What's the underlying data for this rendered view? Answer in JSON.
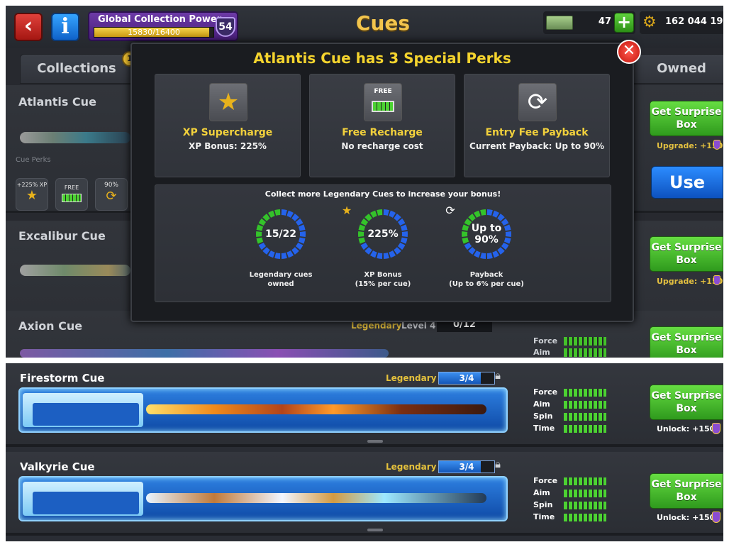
{
  "header": {
    "title": "Cues",
    "collection_power": {
      "label": "Global Collection Power",
      "progress": "15830/16400",
      "fraction": 0.965,
      "level": "54"
    },
    "cash": "47",
    "coins": "162 044 19",
    "back_icon": "chevron-left-icon",
    "info_icon": "info-icon"
  },
  "tabs": {
    "collections": "Collections",
    "owned": "Owned",
    "badge": "1"
  },
  "background_rows": [
    {
      "name": "Atlantis Cue",
      "button": "Get Surprise Box",
      "upgrade": "Upgrade: +150"
    },
    {
      "name": "Excalibur Cue",
      "button": "Get Surprise Box",
      "upgrade": "Upgrade: +150"
    },
    {
      "name": "Axion Cue",
      "tag": "Legendary",
      "level": "Level 4",
      "progress": "0/12",
      "button": "Get Surprise Box"
    }
  ],
  "atlantis_perks_chips": {
    "label": "Cue Perks",
    "xp": "+225% XP",
    "free": "FREE",
    "payback": "90%"
  },
  "use_button": "Use",
  "small_stats": [
    "Force",
    "Aim"
  ],
  "modal": {
    "title": "Atlantis Cue has 3 Special Perks",
    "perks": [
      {
        "name": "XP Supercharge",
        "desc": "XP Bonus: 225%",
        "icon": "star-chevron-icon"
      },
      {
        "name": "Free Recharge",
        "desc": "No recharge cost",
        "icon": "battery-icon",
        "icon_text": "FREE"
      },
      {
        "name": "Entry Fee Payback",
        "desc": "Current Payback: Up to 90%",
        "icon": "coin-cycle-icon"
      }
    ],
    "bonus_title": "Collect more Legendary Cues to increase your bonus!",
    "rings": [
      {
        "value": "15/22",
        "label1": "Legendary cues",
        "label2": "owned",
        "fill": 0.68
      },
      {
        "value": "225%",
        "label1": "XP Bonus",
        "label2": "(15% per cue)",
        "fill": 0.68
      },
      {
        "value": "Up to 90%",
        "label1": "Payback",
        "label2": "(Up to 6% per cue)",
        "fill": 0.68
      }
    ]
  },
  "bottom_rows": [
    {
      "name": "Firestorm Cue",
      "tag": "Legendary",
      "progress": "3/4",
      "fraction": 0.75,
      "stats": [
        "Force",
        "Aim",
        "Spin",
        "Time"
      ],
      "button": "Get Surprise Box",
      "unlock": "Unlock: +150"
    },
    {
      "name": "Valkyrie Cue",
      "tag": "Legendary",
      "progress": "3/4",
      "fraction": 0.75,
      "stats": [
        "Force",
        "Aim",
        "Spin",
        "Time"
      ],
      "button": "Get Surprise Box",
      "unlock": "Unlock: +150"
    }
  ],
  "colors": {
    "accent_gold": "#f5d42e",
    "ring_blue": "#2563eb",
    "ring_green": "#34c32a",
    "button_green": "#3aa822"
  }
}
